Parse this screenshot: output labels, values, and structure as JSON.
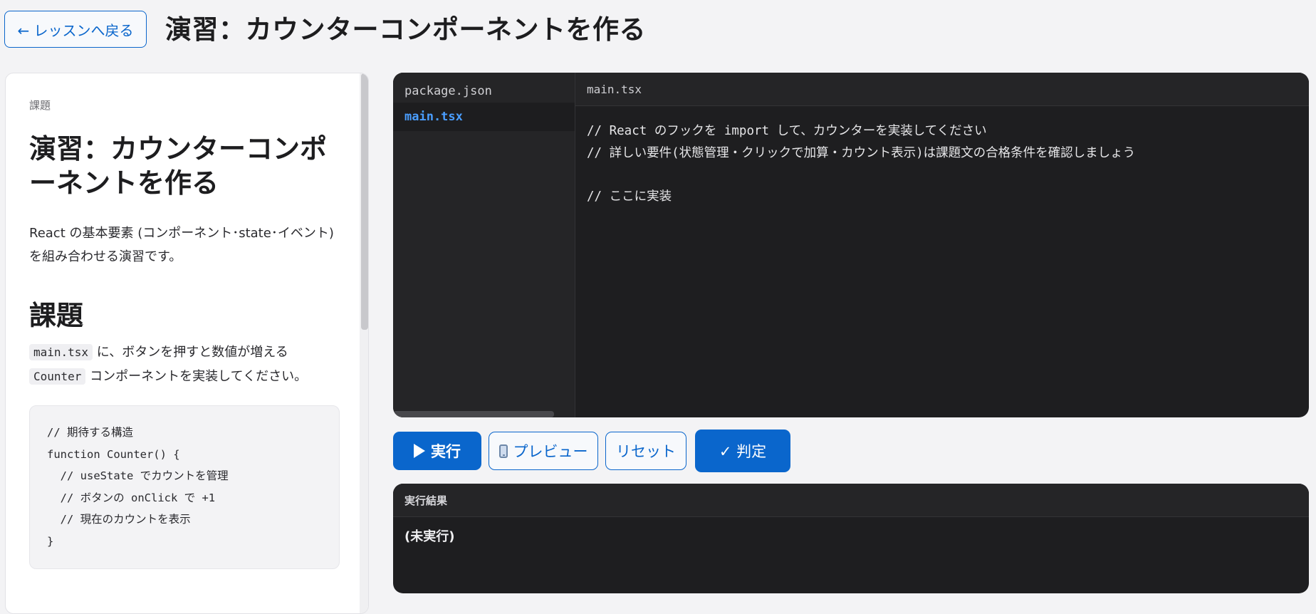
{
  "header": {
    "back_label": "← レッスンへ戻る",
    "title": "演習：カウンターコンポーネントを作る"
  },
  "task": {
    "eyebrow": "課題",
    "title": "演習：カウンターコンポーネントを作る",
    "description": "React の基本要素 (コンポーネント･state･イベント) を組み合わせる演習です。",
    "section_title": "課題",
    "body_code1": "main.tsx",
    "body_text1": "に、ボタンを押すと数値が増える",
    "body_code2": "Counter",
    "body_text2": "コンポーネントを実装してください。",
    "code_block": "// 期待する構造\nfunction Counter() {\n  // useState でカウントを管理\n  // ボタンの onClick で +1\n  // 現在のカウントを表示\n}"
  },
  "editor": {
    "files": [
      "package.json",
      "main.tsx"
    ],
    "active_file": "main.tsx",
    "tab_label": "main.tsx",
    "code": "// React のフックを import して、カウンターを実装してください\n// 詳しい要件(状態管理・クリックで加算・カウント表示)は課題文の合格条件を確認しましょう\n\n// ここに実装"
  },
  "toolbar": {
    "run_label": "実行",
    "preview_label": "プレビュー",
    "reset_label": "リセット",
    "judge_label": "✓ 判定"
  },
  "output": {
    "header": "実行結果",
    "body": "(未実行)"
  },
  "colors": {
    "accent": "#0a66cc",
    "editor_bg": "#1e1e20",
    "active_file": "#4a9eff"
  }
}
